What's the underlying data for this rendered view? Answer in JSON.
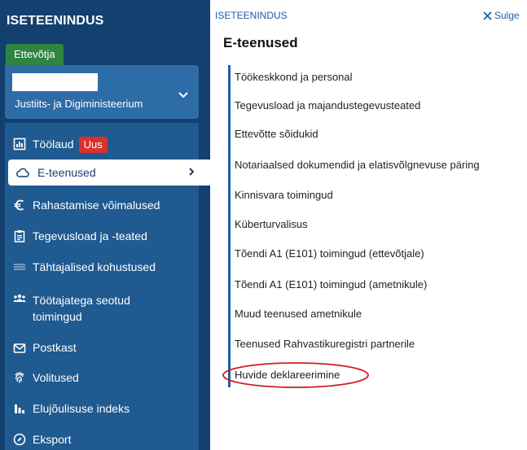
{
  "sidebar": {
    "title": "ISETEENINDUS",
    "role_tab": "Ettevõtja",
    "account": {
      "organization": "Justiits- ja Digiministeerium"
    },
    "nav": [
      {
        "label": "Töölaud",
        "badge": "Uus",
        "icon": "dashboard-icon"
      },
      {
        "label": "E-teenused",
        "icon": "cloud-icon",
        "active": true
      },
      {
        "label": "Rahastamise võimalused",
        "icon": "euro-icon"
      },
      {
        "label": "Tegevusload ja -teated",
        "icon": "clipboard-icon"
      },
      {
        "label": "Tähtajalised kohustused",
        "icon": "list-icon"
      },
      {
        "label": "Töötajatega seotud toimingud",
        "icon": "people-icon"
      },
      {
        "label": "Postkast",
        "icon": "mail-icon"
      },
      {
        "label": "Volitused",
        "icon": "fingerprint-icon"
      },
      {
        "label": "Elujõulisuse indeks",
        "icon": "bar-chart-icon"
      },
      {
        "label": "Eksport",
        "icon": "compass-icon"
      }
    ]
  },
  "panel": {
    "breadcrumb": "ISETEENINDUS",
    "close_label": "Sulge",
    "heading": "E-teenused",
    "services": [
      "Töökeskkond ja personal",
      "Tegevusload ja majandustegevusteated",
      "Ettevõtte sõidukid",
      "Notariaalsed dokumendid ja elatisvõlgnevuse päring",
      "Kinnisvara toimingud",
      "Küberturvalisus",
      "Tõendi A1 (E101) toimingud (ettevõtjale)",
      "Tõendi A1 (E101) toimingud (ametnikule)",
      "Muud teenused ametnikule",
      "Teenused Rahvastikuregistri partnerile",
      "Huvide deklareerimine"
    ]
  },
  "colors": {
    "sidebar_bg": "#13406e",
    "nav_bg": "#1f5a90",
    "account_bg": "#2d6ca7",
    "role_tab": "#2e8540",
    "badge": "#d9322d",
    "link": "#1d5fa4",
    "annotation": "#d0201e"
  }
}
